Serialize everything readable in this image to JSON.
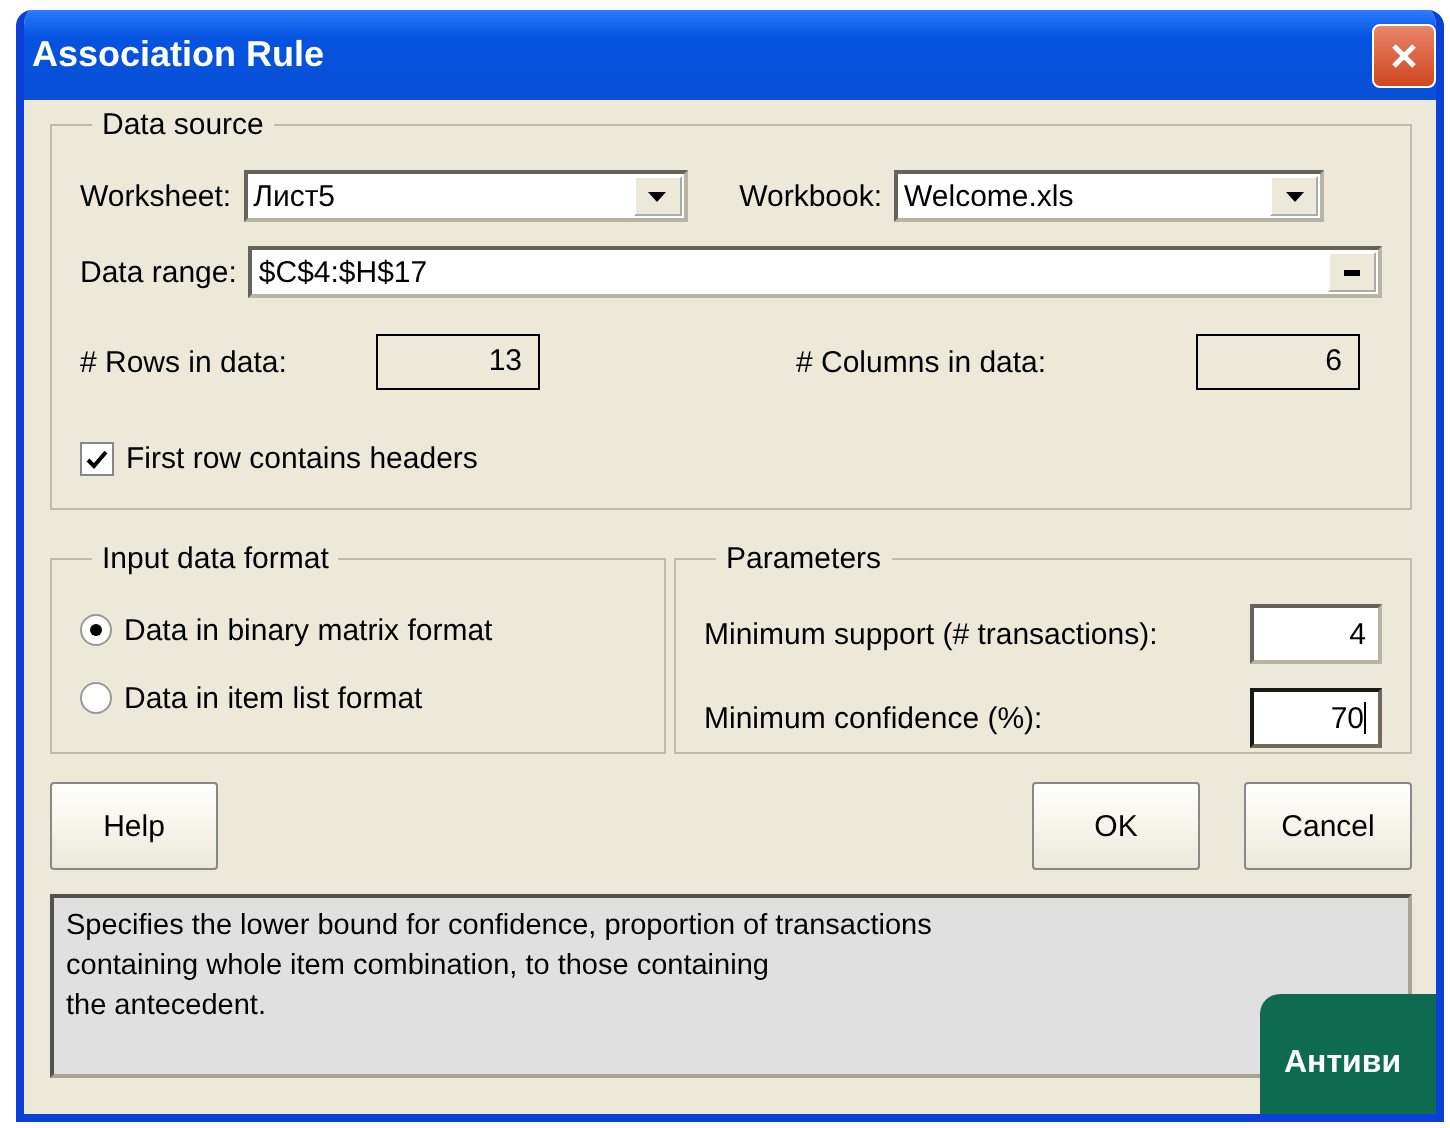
{
  "window": {
    "title": "Association Rule"
  },
  "data_source": {
    "title": "Data source",
    "worksheet": {
      "label": "Worksheet:",
      "value": "Лист5"
    },
    "workbook": {
      "label": "Workbook:",
      "value": "Welcome.xls"
    },
    "data_range": {
      "label": "Data range:",
      "value": "$C$4:$H$17"
    },
    "rows": {
      "label": "# Rows in data:",
      "value": "13"
    },
    "columns": {
      "label": "# Columns in data:",
      "value": "6"
    },
    "headers_option": {
      "label": "First row contains headers",
      "checked": true
    }
  },
  "input_format": {
    "title": "Input data format",
    "options": [
      {
        "label": "Data in binary matrix format",
        "selected": true
      },
      {
        "label": "Data in item list format",
        "selected": false
      }
    ]
  },
  "parameters": {
    "title": "Parameters",
    "fields": [
      {
        "label": "Minimum support (# transactions):",
        "value": "4",
        "focused": false
      },
      {
        "label": "Minimum confidence (%):",
        "value": "70",
        "focused": true
      }
    ]
  },
  "buttons_left": [
    {
      "label": "Help"
    }
  ],
  "buttons_right": [
    {
      "label": "OK"
    },
    {
      "label": "Cancel"
    }
  ],
  "description": "Specifies the lower bound for confidence, proportion of transactions\ncontaining whole item combination, to those containing\nthe antecedent.",
  "overlay_badge": {
    "label": "Антиви"
  }
}
